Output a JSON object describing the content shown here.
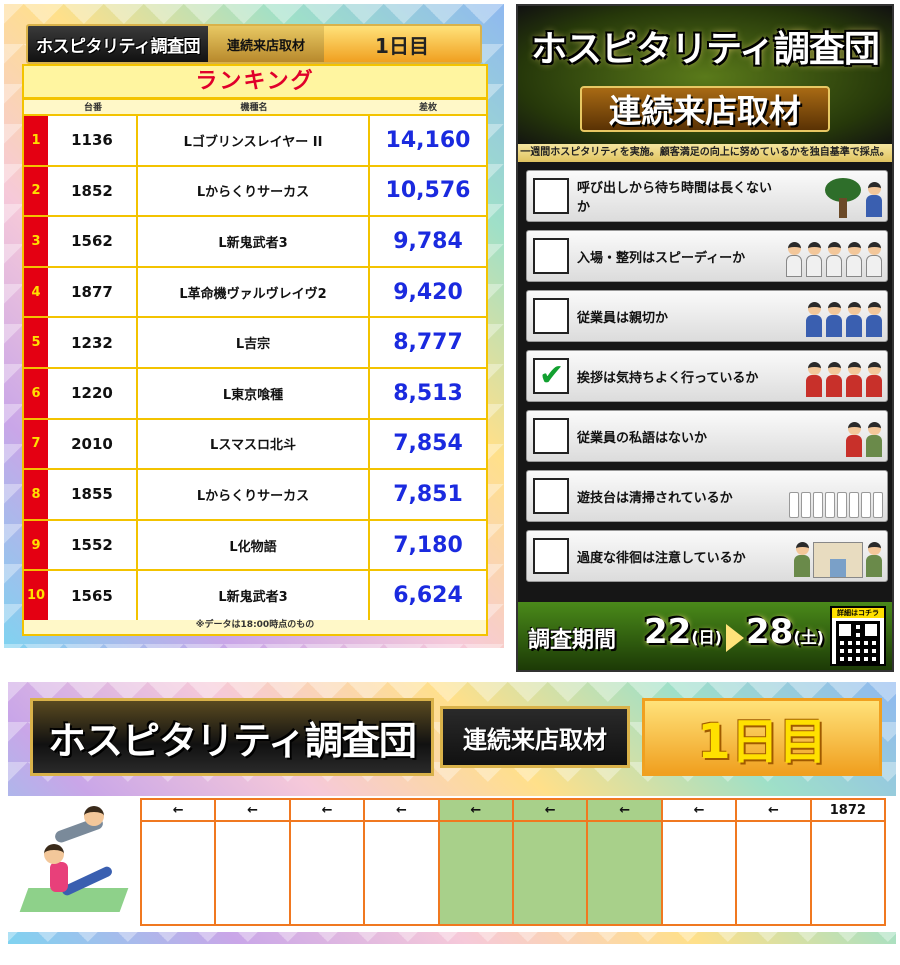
{
  "ranking_panel": {
    "banner": {
      "main": "ホスピタリティ調査団",
      "sub": "連続来店取材",
      "day": "1日目"
    },
    "title": "ランキング",
    "headers": {
      "unit": "台番",
      "name": "機種名",
      "diff": "差枚"
    },
    "rows": [
      {
        "rank": "1",
        "unit": "1136",
        "name": "Lゴブリンスレイヤー II",
        "diff": "14,160"
      },
      {
        "rank": "2",
        "unit": "1852",
        "name": "Lからくりサーカス",
        "diff": "10,576"
      },
      {
        "rank": "3",
        "unit": "1562",
        "name": "L新鬼武者3",
        "diff": "9,784"
      },
      {
        "rank": "4",
        "unit": "1877",
        "name": "L革命機ヴァルヴレイヴ2",
        "diff": "9,420"
      },
      {
        "rank": "5",
        "unit": "1232",
        "name": "L吉宗",
        "diff": "8,777"
      },
      {
        "rank": "6",
        "unit": "1220",
        "name": "L東京喰種",
        "diff": "8,513"
      },
      {
        "rank": "7",
        "unit": "2010",
        "name": "Lスマスロ北斗",
        "diff": "7,854"
      },
      {
        "rank": "8",
        "unit": "1855",
        "name": "Lからくりサーカス",
        "diff": "7,851"
      },
      {
        "rank": "9",
        "unit": "1552",
        "name": "L化物語",
        "diff": "7,180"
      },
      {
        "rank": "10",
        "unit": "1565",
        "name": "L新鬼武者3",
        "diff": "6,624"
      }
    ],
    "note": "※データは18:00時点のもの"
  },
  "survey_panel": {
    "title": "ホスピタリティ調査団",
    "subtitle": "連続来店取材",
    "caption": "一週間ホスピタリティを実施。顧客満足の向上に努めているかを独自基準で採点。",
    "items": [
      {
        "text": "呼び出しから待ち時間は長くないか",
        "checked": false,
        "art": "waiting-staff"
      },
      {
        "text": "入場・整列はスピーディーか",
        "checked": false,
        "art": "line-of-customers"
      },
      {
        "text": "従業員は親切か",
        "checked": false,
        "art": "friendly-staff"
      },
      {
        "text": "挨拶は気持ちよく行っているか",
        "checked": true,
        "art": "greeting-staff"
      },
      {
        "text": "従業員の私語はないか",
        "checked": false,
        "art": "chatting-staff"
      },
      {
        "text": "遊技台は清掃されているか",
        "checked": false,
        "art": "slot-machines"
      },
      {
        "text": "過度な徘徊は注意しているか",
        "checked": false,
        "art": "wandering-people"
      }
    ],
    "checkmark": "✔",
    "period": {
      "label": "調査期間",
      "start_day": "22",
      "start_weekday": "(日)",
      "end_day": "28",
      "end_weekday": "(土)"
    },
    "qr_caption": "詳細はコチラ"
  },
  "bottom_panel": {
    "banner": {
      "main": "ホスピタリティ調査団",
      "sub": "連続来店取材",
      "day": "1日目"
    },
    "slots": [
      {
        "label": "←",
        "highlight": false
      },
      {
        "label": "←",
        "highlight": false
      },
      {
        "label": "←",
        "highlight": false
      },
      {
        "label": "←",
        "highlight": false
      },
      {
        "label": "←",
        "highlight": true
      },
      {
        "label": "←",
        "highlight": true
      },
      {
        "label": "←",
        "highlight": true
      },
      {
        "label": "←",
        "highlight": false
      },
      {
        "label": "←",
        "highlight": false
      },
      {
        "label": "1872",
        "highlight": false
      }
    ]
  },
  "colors": {
    "rank_red": "#e40012",
    "rank_yellow": "#ffe000",
    "diff_blue": "#1a2adf",
    "frame_gold": "#f3c300",
    "slot_orange": "#f07820",
    "slot_green": "#a8d08a",
    "check_green": "#12a030"
  }
}
